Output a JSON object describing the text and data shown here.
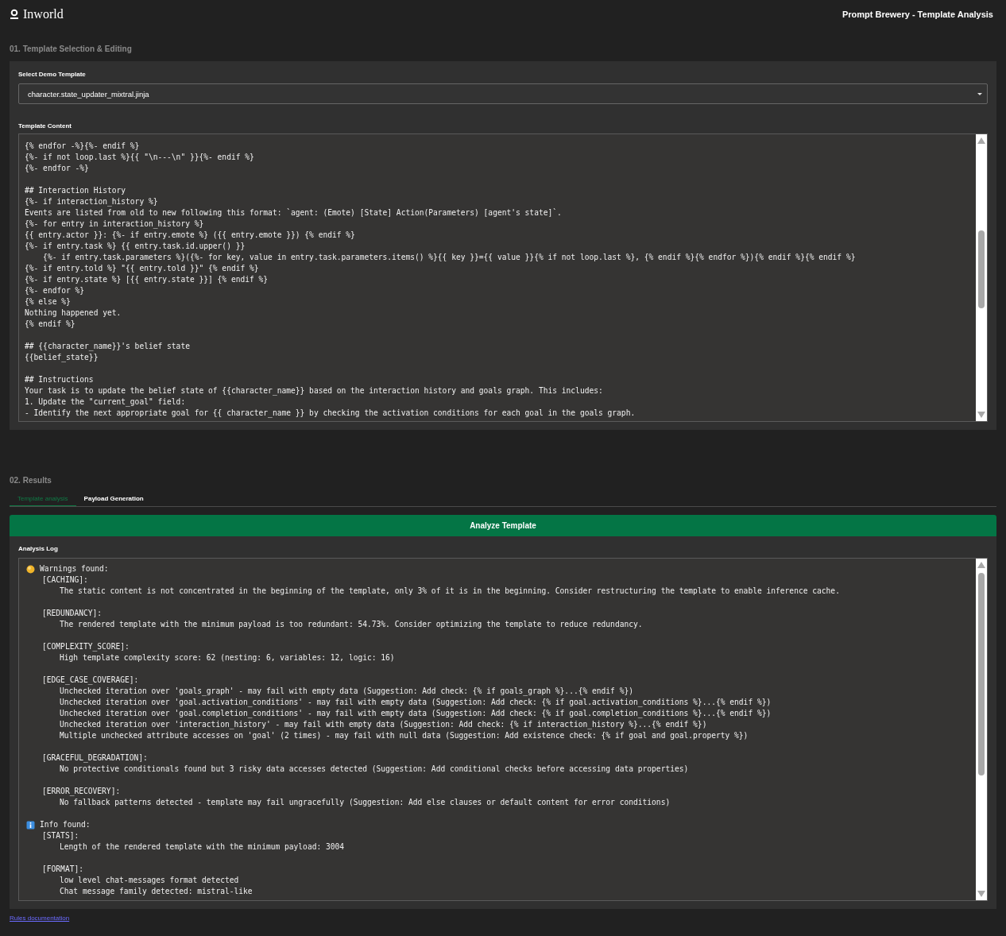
{
  "header": {
    "brand": "Inworld",
    "title": "Prompt Brewery - Template Analysis"
  },
  "section_1": {
    "title": "01. Template Selection & Editing",
    "select": {
      "label": "Select Demo Template",
      "value": "character.state_updater_mixtral.jinja"
    },
    "editor": {
      "label": "Template Content",
      "blocks": [
        [
          "{% endfor -%}{%- endif %}",
          "{%- if not loop.last %}{{ \"\\n---\\n\" }}{%- endif %}",
          "{%- endfor -%}"
        ],
        [
          "## Interaction History",
          "{%- if interaction_history %}",
          "Events are listed from old to new following this format: `agent: (Emote) [State] Action(Parameters) [agent's state]`.",
          "{%- for entry in interaction_history %}",
          "{{ entry.actor }}: {%- if entry.emote %} ({{ entry.emote }}) {% endif %}",
          "{%- if entry.task %} {{ entry.task.id.upper() }}",
          "    {%- if entry.task.parameters %}({%- for key, value in entry.task.parameters.items() %}{{ key }}={{ value }}{% if not loop.last %}, {% endif %}{% endfor %}){% endif %}{% endif %}",
          "{%- if entry.told %} \"{{ entry.told }}\" {% endif %}",
          "{%- if entry.state %} [{{ entry.state }}] {% endif %}",
          "{%- endfor %}",
          "{% else %}",
          "Nothing happened yet.",
          "{% endif %}"
        ],
        [
          "## {{character_name}}'s belief state",
          "{{belief_state}}"
        ],
        [
          "## Instructions",
          "Your task is to update the belief state of {{character_name}} based on the interaction history and goals graph. This includes:",
          "1. Update the \"current_goal\" field:",
          "- Identify the next appropriate goal for {{ character_name }} by checking the activation conditions for each goal in the goals graph."
        ]
      ]
    }
  },
  "section_2": {
    "title": "02. Results",
    "tabs": [
      {
        "label": "Template analysis",
        "selected": true
      },
      {
        "label": "Payload Generation",
        "selected": false
      }
    ],
    "analyze_button": "Analyze Template",
    "log": {
      "label": "Analysis Log",
      "sections": [
        {
          "kind": "warning",
          "title": "Warnings found:",
          "groups": [
            {
              "tag": "[CACHING]:",
              "lines": [
                "The static content is not concentrated in the beginning of the template, only 3% of it is in the beginning. Consider restructuring the template to enable inference cache."
              ]
            },
            {
              "tag": "[REDUNDANCY]:",
              "lines": [
                "The rendered template with the minimum payload is too redundant: 54.73%. Consider optimizing the template to reduce redundancy."
              ]
            },
            {
              "tag": "[COMPLEXITY_SCORE]:",
              "lines": [
                "High template complexity score: 62 (nesting: 6, variables: 12, logic: 16)"
              ]
            },
            {
              "tag": "[EDGE_CASE_COVERAGE]:",
              "lines": [
                "Unchecked iteration over 'goals_graph' - may fail with empty data (Suggestion: Add check: {% if goals_graph %}...{% endif %})",
                "Unchecked iteration over 'goal.activation_conditions' - may fail with empty data (Suggestion: Add check: {% if goal.activation_conditions %}...{% endif %})",
                "Unchecked iteration over 'goal.completion_conditions' - may fail with empty data (Suggestion: Add check: {% if goal.completion_conditions %}...{% endif %})",
                "Unchecked iteration over 'interaction_history' - may fail with empty data (Suggestion: Add check: {% if interaction_history %}...{% endif %})",
                "Multiple unchecked attribute accesses on 'goal' (2 times) - may fail with null data (Suggestion: Add existence check: {% if goal and goal.property %})"
              ]
            },
            {
              "tag": "[GRACEFUL_DEGRADATION]:",
              "lines": [
                "No protective conditionals found but 3 risky data accesses detected (Suggestion: Add conditional checks before accessing data properties)"
              ]
            },
            {
              "tag": "[ERROR_RECOVERY]:",
              "lines": [
                "No fallback patterns detected - template may fail ungracefully (Suggestion: Add else clauses or default content for error conditions)"
              ]
            }
          ]
        },
        {
          "kind": "info",
          "title": "Info found:",
          "groups": [
            {
              "tag": "[STATS]:",
              "lines": [
                "Length of the rendered template with the minimum payload: 3004"
              ]
            },
            {
              "tag": "[FORMAT]:",
              "lines": [
                "low level chat-messages format detected",
                "Chat message family detected: mistral-like"
              ]
            }
          ]
        }
      ]
    }
  },
  "footer_link": "Rules documentation"
}
